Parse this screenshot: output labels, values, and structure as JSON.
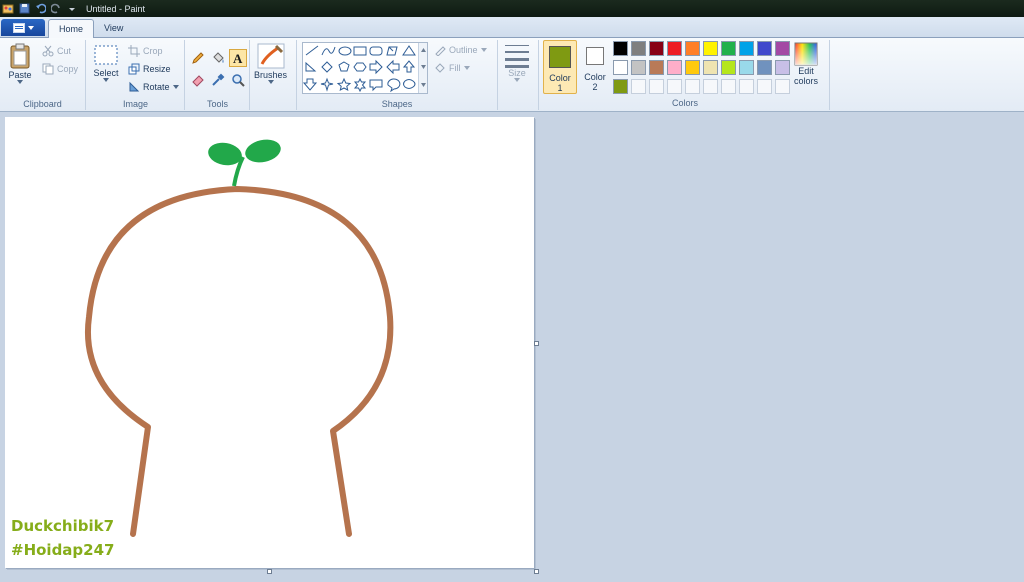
{
  "window": {
    "title": "Untitled - Paint",
    "quick_access_icons": [
      "paint-app-icon",
      "save-icon",
      "undo-icon",
      "redo-icon",
      "customize-dropdown-icon"
    ]
  },
  "tabs": [
    {
      "label": "Home",
      "active": true
    },
    {
      "label": "View",
      "active": false
    }
  ],
  "ribbon": {
    "clipboard": {
      "label": "Clipboard",
      "paste": "Paste",
      "cut": "Cut",
      "copy": "Copy"
    },
    "image": {
      "label": "Image",
      "select": "Select",
      "crop": "Crop",
      "resize": "Resize",
      "rotate": "Rotate"
    },
    "tools": {
      "label": "Tools",
      "items": [
        "pencil-icon",
        "fill-bucket-icon",
        "text-icon",
        "eraser-icon",
        "color-picker-icon",
        "magnifier-icon"
      ],
      "selected": "text-icon"
    },
    "brushes": {
      "label": "Brushes"
    },
    "shapes": {
      "label": "Shapes",
      "outline": "Outline",
      "fill": "Fill"
    },
    "size": {
      "label": "Size"
    },
    "colors": {
      "label": "Colors",
      "color1_label": "Color",
      "color1_num": "1",
      "color2_label": "Color",
      "color2_num": "2",
      "color1_value": "#7f9a12",
      "color2_value": "#ffffff",
      "edit_label_1": "Edit",
      "edit_label_2": "colors",
      "palette_row1": [
        "#000000",
        "#7f7f7f",
        "#880015",
        "#ed1c24",
        "#ff7f27",
        "#fff200",
        "#22b14c",
        "#00a2e8",
        "#3f48cc",
        "#a349a4"
      ],
      "palette_row2": [
        "#ffffff",
        "#c3c3c3",
        "#b97a57",
        "#ffaec9",
        "#ffc90e",
        "#efe4b0",
        "#b5e61d",
        "#99d9ea",
        "#7092be",
        "#c8bfe7"
      ],
      "palette_row3": [
        "#7f9a12"
      ]
    }
  },
  "canvas": {
    "outline_color": "#b5734d",
    "sprout_color": "#22a84a",
    "watermark_line1": "Duckchibik7",
    "watermark_line2": "#Hoidap247"
  }
}
